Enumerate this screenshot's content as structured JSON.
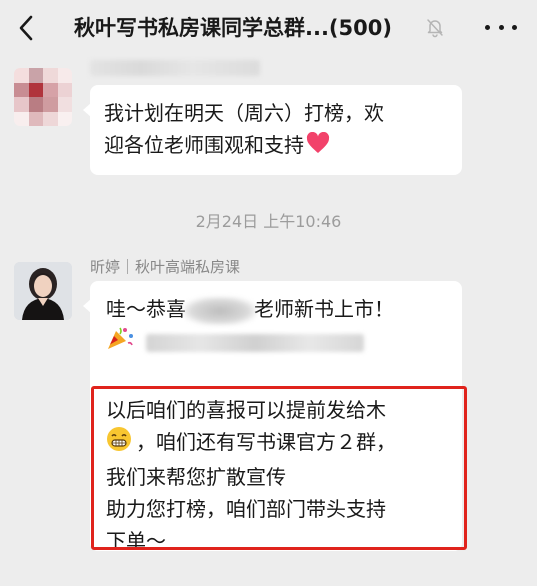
{
  "header": {
    "title": "秋叶写书私房课同学总群...(500)"
  },
  "messages": [
    {
      "line1": "我计划在明天（周六）打榜，欢",
      "line2": "迎各位老师围观和支持"
    }
  ],
  "timestamp": "2月24日 上午10:46",
  "second": {
    "sender": "昕婷｜秋叶高端私房课",
    "greet_part1": "哇～恭喜",
    "greet_part2": "老师新书上市！",
    "p1": "以后咱们的喜报可以提前发给木",
    "p2": "，咱们还有写书课官方２群，",
    "p3": "我们来帮您扩散宣传",
    "p4": "助力您打榜，咱们部门带头支持",
    "p5": "下单～"
  },
  "colors": {
    "background": "#ededed",
    "bubble": "#ffffff",
    "highlight": "#e0231c",
    "timestamp": "#9c9c9c"
  },
  "icons": [
    "back-icon",
    "mute-bell-icon",
    "more-icon",
    "heart-emoji-icon",
    "party-popper-emoji-icon",
    "grin-emoji-icon"
  ]
}
